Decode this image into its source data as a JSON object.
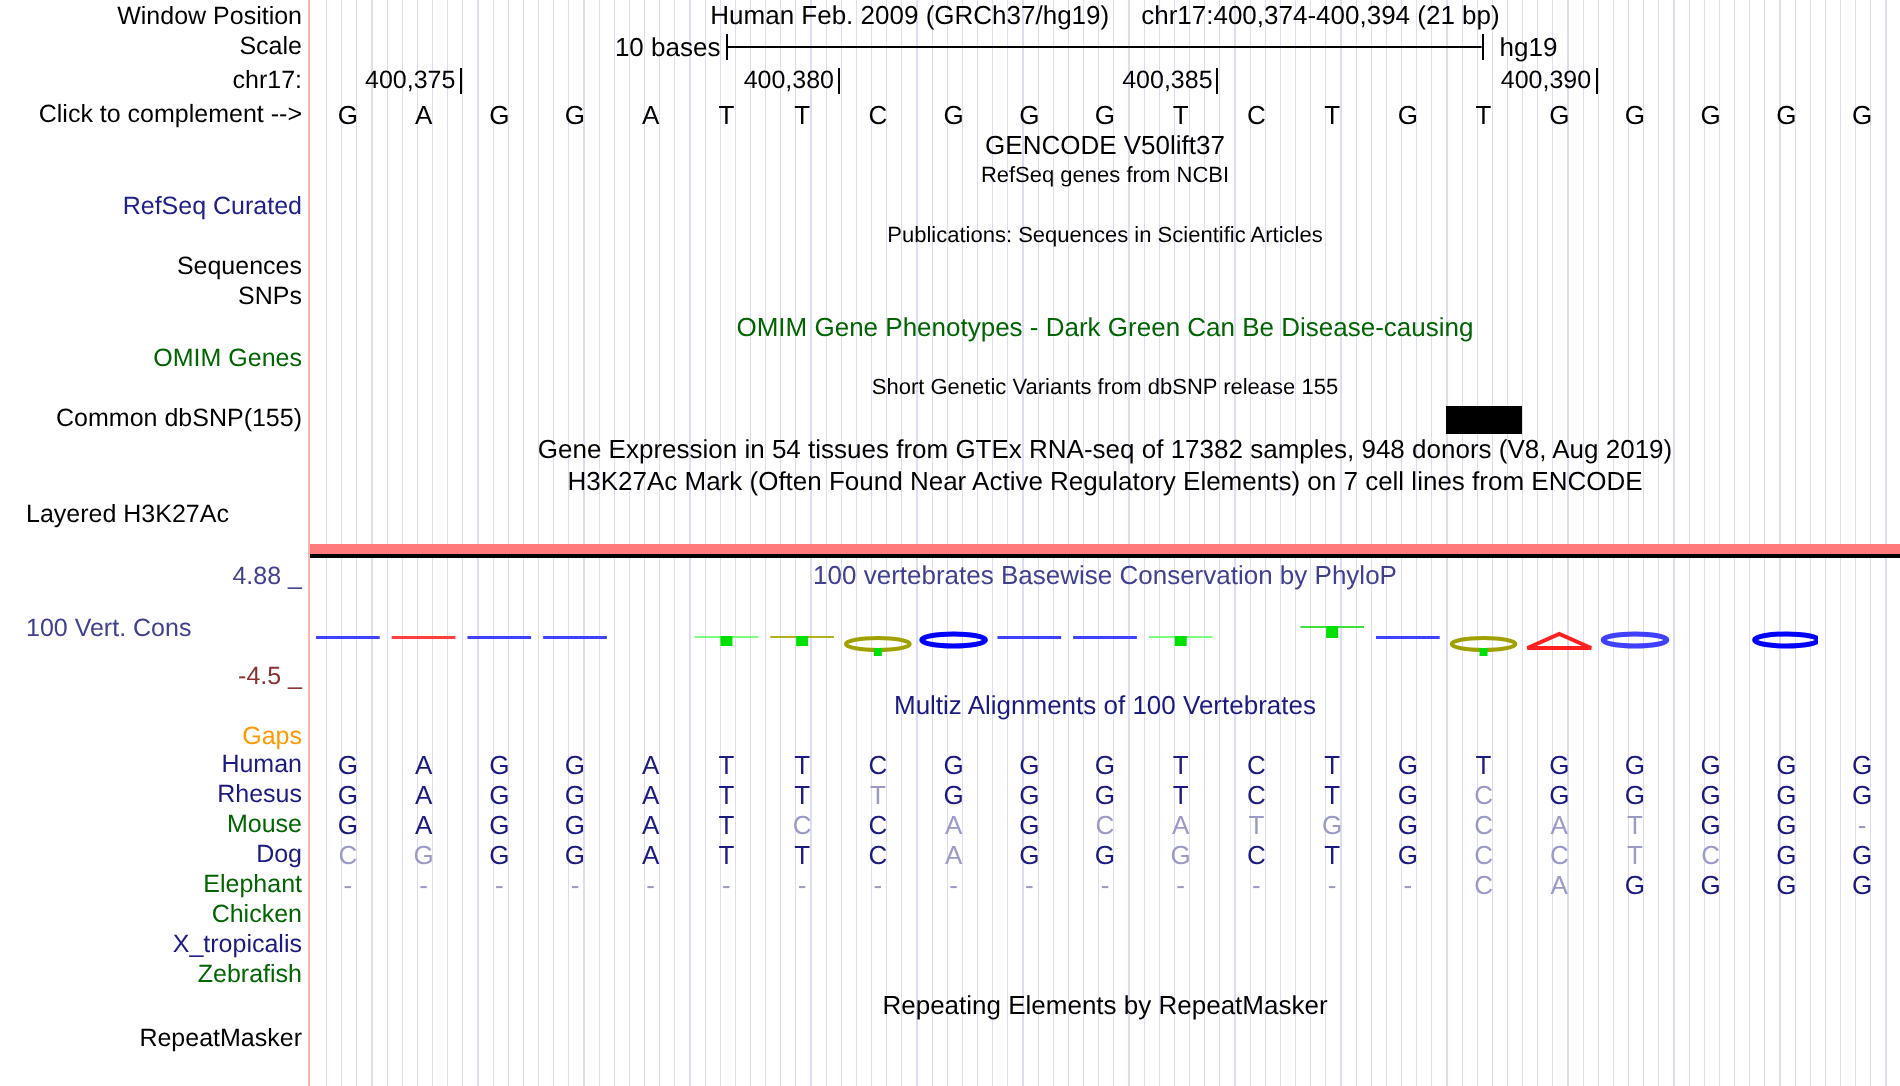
{
  "position_bar": {
    "label": "Window Position",
    "assembly": "Human Feb. 2009 (GRCh37/hg19)",
    "region": "chr17:400,374-400,394 (21 bp)"
  },
  "scale": {
    "label": "Scale",
    "span": "10 bases",
    "assembly": "hg19"
  },
  "coordinates": {
    "label": "chr17:",
    "ticks": [
      "400,375",
      "400,380",
      "400,385",
      "400,390"
    ]
  },
  "reference": {
    "label": "Click to complement -->",
    "bases": [
      "G",
      "A",
      "G",
      "G",
      "A",
      "T",
      "T",
      "C",
      "G",
      "G",
      "G",
      "T",
      "C",
      "T",
      "G",
      "T",
      "G",
      "G",
      "G",
      "G",
      "G"
    ]
  },
  "tracks": [
    {
      "kind": "title",
      "text": "GENCODE V50lift37",
      "color": "#000000"
    },
    {
      "kind": "caption",
      "text": "RefSeq genes from NCBI",
      "color": "#000000"
    },
    {
      "kind": "label",
      "text": "RefSeq Curated",
      "color": "#20208c"
    },
    {
      "kind": "caption",
      "text": "Publications: Sequences in Scientific Articles",
      "color": "#000000"
    },
    {
      "kind": "label",
      "text": "Sequences",
      "color": "#000000"
    },
    {
      "kind": "label",
      "text": "SNPs",
      "color": "#000000"
    },
    {
      "kind": "title",
      "text": "OMIM Gene Phenotypes - Dark Green Can Be Disease-causing",
      "color": "#006400"
    },
    {
      "kind": "label",
      "text": "OMIM Genes",
      "color": "#006400"
    },
    {
      "kind": "caption",
      "text": "Short Genetic Variants from dbSNP release 155",
      "color": "#000000"
    },
    {
      "kind": "snp_label",
      "text": "Common dbSNP(155)",
      "color": "#000000"
    },
    {
      "kind": "title",
      "text": "Gene Expression in 54 tissues from GTEx RNA-seq of 17382 samples, 948 donors (V8, Aug 2019)",
      "color": "#000000"
    },
    {
      "kind": "title",
      "text": "H3K27Ac Mark (Often Found Near Active Regulatory Elements) on 7 cell lines from ENCODE",
      "color": "#000000"
    },
    {
      "kind": "left_label",
      "text": "Layered H3K27Ac",
      "color": "#000000"
    }
  ],
  "conservation": {
    "max": "4.88 _",
    "title": "100 vertebrates Basewise Conservation by PhyloP",
    "label": "100 Vert. Cons",
    "min": "-4.5 _"
  },
  "alignment": {
    "title": "Multiz Alignments of 100 Vertebrates",
    "gaps_label": "Gaps",
    "species": [
      {
        "name": "Human",
        "color": "#1a1a80",
        "bases": [
          "G",
          "A",
          "G",
          "G",
          "A",
          "T",
          "T",
          "C",
          "G",
          "G",
          "G",
          "T",
          "C",
          "T",
          "G",
          "T",
          "G",
          "G",
          "G",
          "G",
          "G"
        ],
        "mismatch": [
          false,
          false,
          false,
          false,
          false,
          false,
          false,
          false,
          false,
          false,
          false,
          false,
          false,
          false,
          false,
          false,
          false,
          false,
          false,
          false,
          false
        ]
      },
      {
        "name": "Rhesus",
        "color": "#1a1a80",
        "bases": [
          "G",
          "A",
          "G",
          "G",
          "A",
          "T",
          "T",
          "T",
          "G",
          "G",
          "G",
          "T",
          "C",
          "T",
          "G",
          "C",
          "G",
          "G",
          "G",
          "G",
          "G"
        ],
        "mismatch": [
          false,
          false,
          false,
          false,
          false,
          false,
          false,
          true,
          false,
          false,
          false,
          false,
          false,
          false,
          false,
          true,
          false,
          false,
          false,
          false,
          false
        ]
      },
      {
        "name": "Mouse",
        "color": "#006400",
        "bases": [
          "G",
          "A",
          "G",
          "G",
          "A",
          "T",
          "C",
          "C",
          "A",
          "G",
          "C",
          "A",
          "T",
          "G",
          "G",
          "C",
          "A",
          "T",
          "G",
          "G",
          "-"
        ],
        "mismatch": [
          false,
          false,
          false,
          false,
          false,
          false,
          true,
          false,
          true,
          false,
          true,
          true,
          true,
          true,
          false,
          true,
          true,
          true,
          false,
          false,
          true
        ]
      },
      {
        "name": "Dog",
        "color": "#1a1a80",
        "bases": [
          "C",
          "G",
          "G",
          "G",
          "A",
          "T",
          "T",
          "C",
          "A",
          "G",
          "G",
          "G",
          "C",
          "T",
          "G",
          "C",
          "C",
          "T",
          "C",
          "G",
          "G"
        ],
        "mismatch": [
          true,
          true,
          false,
          false,
          false,
          false,
          false,
          false,
          true,
          false,
          false,
          true,
          false,
          false,
          false,
          true,
          true,
          true,
          true,
          false,
          false
        ]
      },
      {
        "name": "Elephant",
        "color": "#006400",
        "bases": [
          "-",
          "-",
          "-",
          "-",
          "-",
          "-",
          "-",
          "-",
          "-",
          "-",
          "-",
          "-",
          "-",
          "-",
          "-",
          "C",
          "A",
          "G",
          "G",
          "G",
          "G"
        ],
        "mismatch": [
          true,
          true,
          true,
          true,
          true,
          true,
          true,
          true,
          true,
          true,
          true,
          true,
          true,
          true,
          true,
          true,
          true,
          false,
          false,
          false,
          false
        ]
      },
      {
        "name": "Chicken",
        "color": "#006400"
      },
      {
        "name": "X_tropicalis",
        "color": "#1a1a80"
      },
      {
        "name": "Zebrafish",
        "color": "#006400"
      }
    ]
  },
  "repeats": {
    "title": "Repeating Elements by RepeatMasker",
    "label": "RepeatMasker"
  }
}
